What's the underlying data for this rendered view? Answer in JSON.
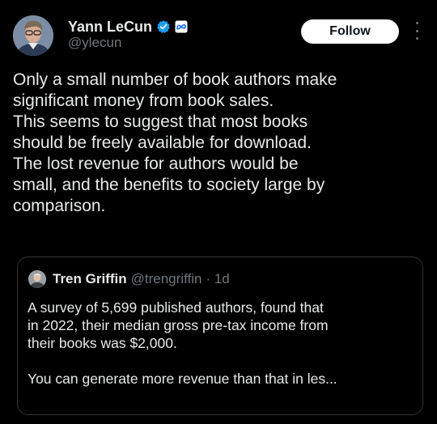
{
  "author": {
    "name": "Yann LeCun",
    "handle": "@ylecun",
    "verified_icon": "verified-badge-icon",
    "affiliation_icon": "meta-logo-icon"
  },
  "actions": {
    "follow_label": "Follow",
    "more_icon": "more-vertical-icon"
  },
  "tweet": {
    "lines": [
      "Only a small number of book authors make",
      "significant money from book sales.",
      "This seems to suggest that most books",
      "should be freely available for download.",
      "The lost revenue for authors would be",
      "small, and the benefits to society large by",
      "comparison."
    ]
  },
  "quote": {
    "name": "Tren Griffin",
    "handle": "@trengriffin",
    "time": "· 1d",
    "paragraph1": [
      "A survey of 5,699 published authors, found that",
      "in 2022, their median gross pre-tax income from",
      "their books was $2,000."
    ],
    "paragraph2": [
      "You can generate more revenue than that in les..."
    ]
  },
  "colors": {
    "background": "#000000",
    "text": "#e7e9ea",
    "secondary": "#71767b",
    "verified": "#1d9bf0",
    "border": "#2f3336"
  }
}
